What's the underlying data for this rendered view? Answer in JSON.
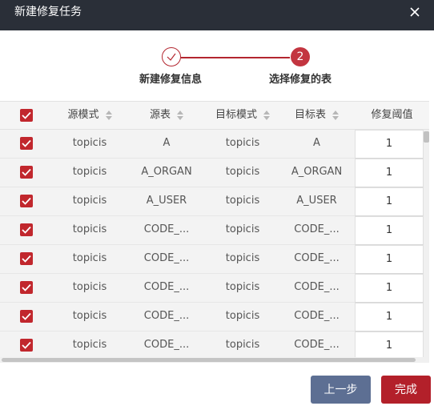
{
  "dialog": {
    "title": "新建修复任务"
  },
  "steps": [
    {
      "label": "新建修复信息",
      "state": "done"
    },
    {
      "label": "选择修复的表",
      "number": "2",
      "state": "active"
    }
  ],
  "table": {
    "columns": [
      {
        "label": "源模式",
        "sortable": true
      },
      {
        "label": "源表",
        "sortable": true
      },
      {
        "label": "目标模式",
        "sortable": true
      },
      {
        "label": "目标表",
        "sortable": true
      },
      {
        "label": "修复阈值",
        "sortable": false
      }
    ],
    "rows": [
      {
        "source_schema": "topicis",
        "source_table": "A",
        "target_schema": "topicis",
        "target_table": "A",
        "threshold": "1",
        "checked": true
      },
      {
        "source_schema": "topicis",
        "source_table": "A_ORGAN",
        "target_schema": "topicis",
        "target_table": "A_ORGAN",
        "threshold": "1",
        "checked": true
      },
      {
        "source_schema": "topicis",
        "source_table": "A_USER",
        "target_schema": "topicis",
        "target_table": "A_USER",
        "threshold": "1",
        "checked": true
      },
      {
        "source_schema": "topicis",
        "source_table": "CODE_...",
        "target_schema": "topicis",
        "target_table": "CODE_...",
        "threshold": "1",
        "checked": true
      },
      {
        "source_schema": "topicis",
        "source_table": "CODE_...",
        "target_schema": "topicis",
        "target_table": "CODE_...",
        "threshold": "1",
        "checked": true
      },
      {
        "source_schema": "topicis",
        "source_table": "CODE_...",
        "target_schema": "topicis",
        "target_table": "CODE_...",
        "threshold": "1",
        "checked": true
      },
      {
        "source_schema": "topicis",
        "source_table": "CODE_...",
        "target_schema": "topicis",
        "target_table": "CODE_...",
        "threshold": "1",
        "checked": true
      },
      {
        "source_schema": "topicis",
        "source_table": "CODE_...",
        "target_schema": "topicis",
        "target_table": "CODE_...",
        "threshold": "1",
        "checked": true
      }
    ]
  },
  "footer": {
    "prev_label": "上一步",
    "done_label": "完成"
  },
  "colors": {
    "accent": "#b3202a",
    "titlebar": "#2a2f38",
    "prev_button": "#5d6f93"
  }
}
